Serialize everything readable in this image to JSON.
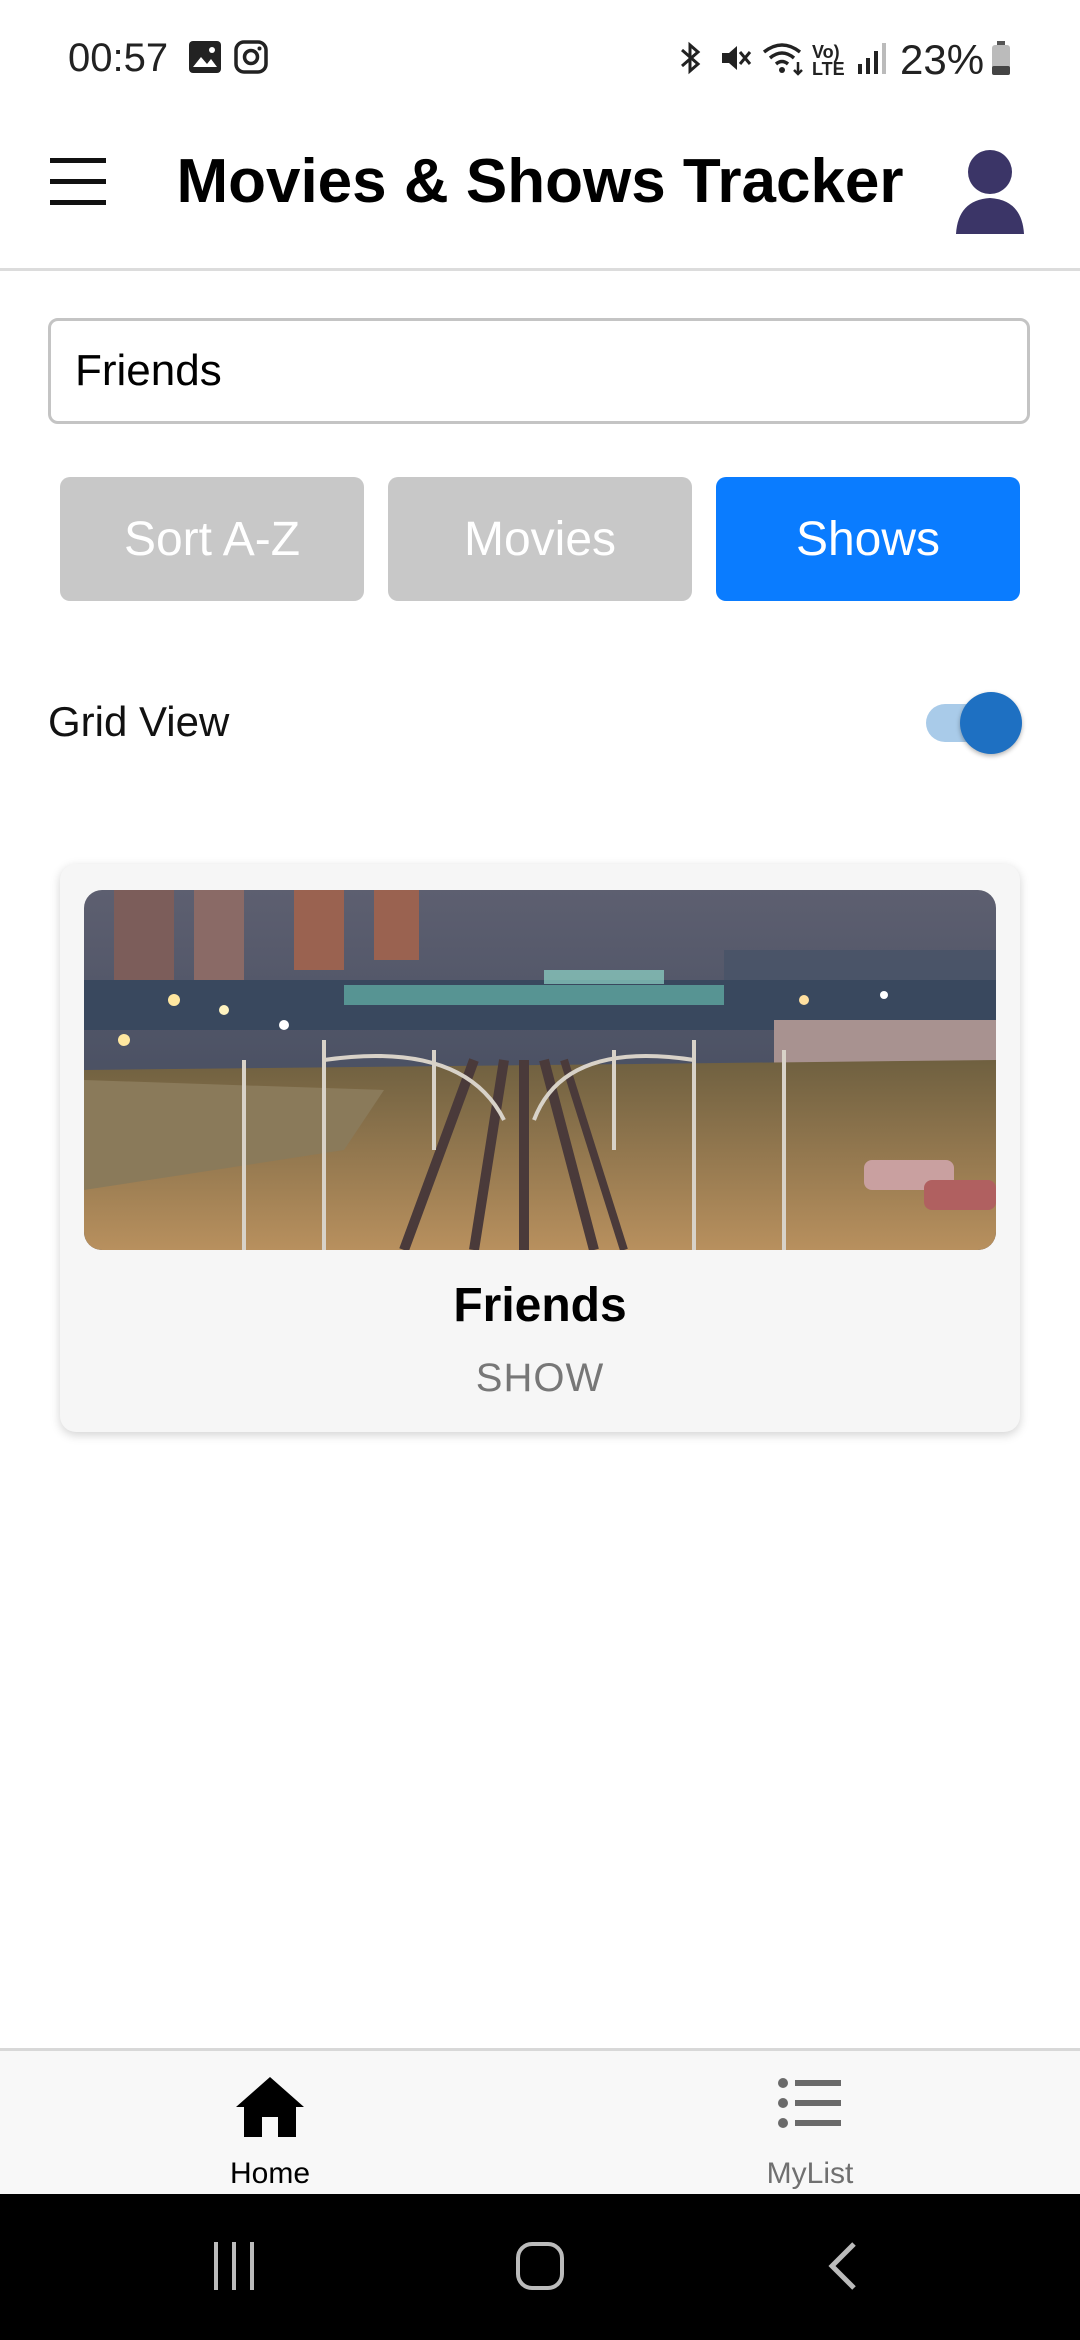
{
  "status_bar": {
    "time": "00:57",
    "battery": "23%",
    "icons": [
      "gallery-icon",
      "instagram-icon",
      "bluetooth-icon",
      "mute-icon",
      "wifi-icon",
      "volte-icon",
      "signal-icon",
      "battery-icon"
    ]
  },
  "header": {
    "title": "Movies & Shows Tracker",
    "menu_icon": "hamburger-menu-icon",
    "profile_icon": "profile-icon"
  },
  "search": {
    "value": "Friends",
    "placeholder": ""
  },
  "filters": [
    {
      "label": "Sort A-Z",
      "active": false
    },
    {
      "label": "Movies",
      "active": false
    },
    {
      "label": "Shows",
      "active": true
    }
  ],
  "grid_view": {
    "label": "Grid View",
    "enabled": true
  },
  "results": [
    {
      "title": "Friends",
      "type": "SHOW"
    }
  ],
  "bottom_nav": [
    {
      "label": "Home",
      "icon": "home-icon",
      "active": true
    },
    {
      "label": "MyList",
      "icon": "list-icon",
      "active": false
    }
  ],
  "colors": {
    "accent": "#0a7cff",
    "inactive_button": "#c8c8c8",
    "toggle_on": "#1e70c2"
  }
}
